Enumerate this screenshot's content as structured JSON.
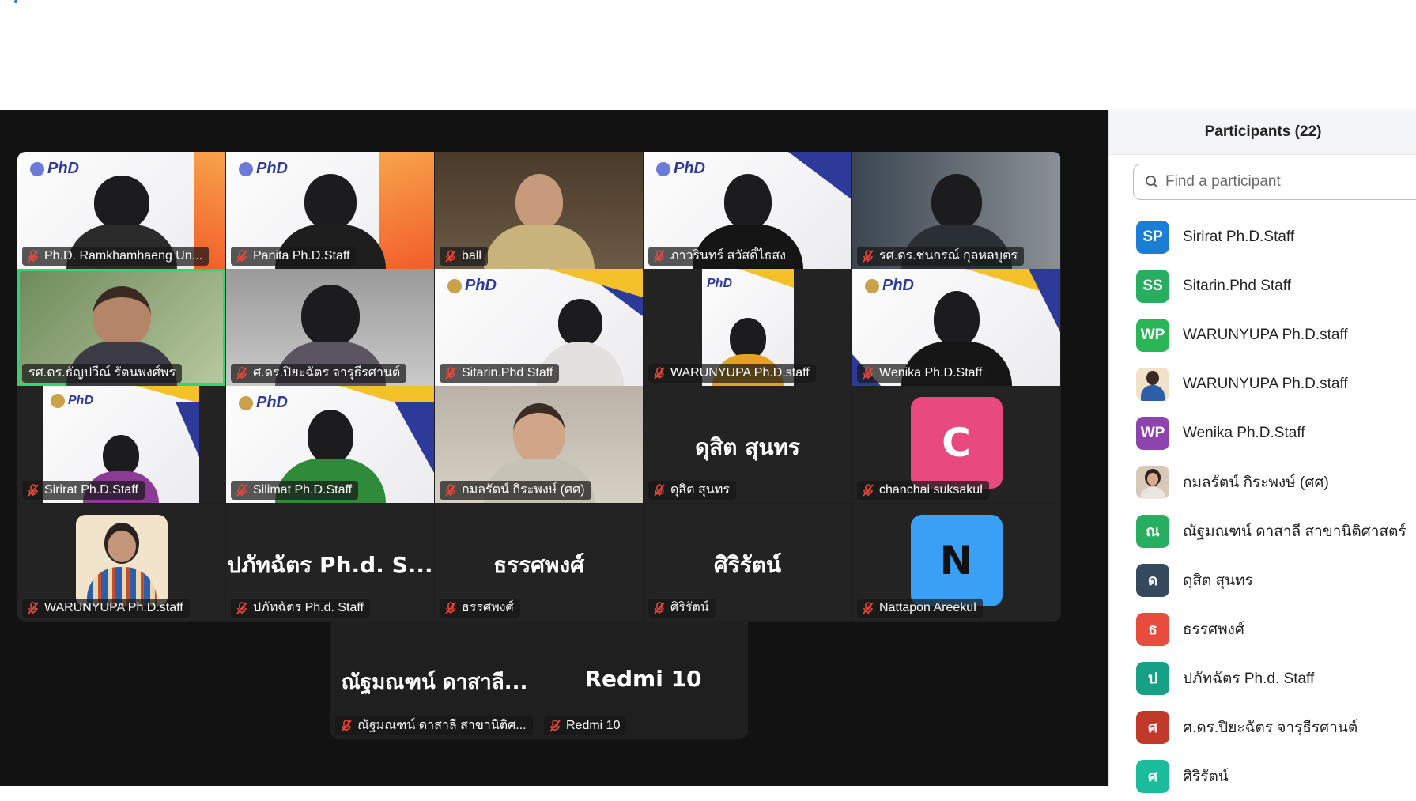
{
  "tiles": [
    {
      "name": "Ph.D. Ramkhamhaeng Un..."
    },
    {
      "name": "Panita Ph.D.Staff"
    },
    {
      "name": "ball"
    },
    {
      "name": "ภาวรินทร์ สวัสดิ์ไธสง"
    },
    {
      "name": "รศ.ดร.ชนกรณ์ กุลหลบุตร"
    },
    {
      "name": "รศ.ดร.ธัญปวีณ์ รัตนพงศ์พร"
    },
    {
      "name": "ศ.ดร.ปิยะฉัตร จารุธีรศานต์"
    },
    {
      "name": "Sitarin.Phd Staff"
    },
    {
      "name": "WARUNYUPA Ph.D.staff"
    },
    {
      "name": "Wenika Ph.D.Staff"
    },
    {
      "name": "Sirirat Ph.D.Staff"
    },
    {
      "name": "Silimat Ph.D.Staff"
    },
    {
      "name": "กมลรัตน์ กิระพงษ์ (ศศ)"
    },
    {
      "name": "ดุสิต  สุนทร",
      "big": "ดุสิต  สุนทร"
    },
    {
      "name": "chanchai suksakul",
      "letter": "C"
    },
    {
      "name": "WARUNYUPA Ph.D.staff"
    },
    {
      "name": "ปภัทฉัตร Ph.d. Staff",
      "big": "ปภัทฉัตร Ph.d. S..."
    },
    {
      "name": "ธรรศพงศ์",
      "big": "ธรรศพงศ์"
    },
    {
      "name": "ศิริรัตน์",
      "big": "ศิริรัตน์"
    },
    {
      "name": "Nattapon Areekul",
      "letter": "N"
    },
    {
      "name": "ณัฐมณฑน์ ดาสาลี สาขานิติศ...",
      "big": "ณัฐมณฑน์ ดาสาลี..."
    },
    {
      "name": "Redmi 10",
      "big": "Redmi 10"
    }
  ],
  "panel": {
    "title": "Participants (22)",
    "search_placeholder": "Find a participant",
    "participants": [
      {
        "initials": "SP",
        "name": "Sirirat Ph.D.Staff",
        "color": "#1a7fd4"
      },
      {
        "initials": "SS",
        "name": "Sitarin.Phd Staff",
        "color": "#27ae60"
      },
      {
        "initials": "WP",
        "name": "WARUNYUPA Ph.D.staff",
        "color": "#2ab657"
      },
      {
        "initials": "",
        "name": "WARUNYUPA Ph.D.staff",
        "color": "#f0e1c8"
      },
      {
        "initials": "WP",
        "name": "Wenika Ph.D.Staff",
        "color": "#8e44ad"
      },
      {
        "initials": "",
        "name": "กมลรัตน์ กิระพงษ์ (ศศ)",
        "color": "#d9c7b8"
      },
      {
        "initials": "ณ",
        "name": "ณัฐมณฑน์ ดาสาลี สาขานิติศาสตร์",
        "color": "#27ae60"
      },
      {
        "initials": "ด",
        "name": "ดุสิต  สุนทร",
        "color": "#34495e"
      },
      {
        "initials": "ธ",
        "name": "ธรรศพงศ์",
        "color": "#e74c3c"
      },
      {
        "initials": "ป",
        "name": "ปภัทฉัตร Ph.d. Staff",
        "color": "#16a085"
      },
      {
        "initials": "ศ",
        "name": "ศ.ดร.ปิยะฉัตร จารุธีรศานต์",
        "color": "#c0392b"
      },
      {
        "initials": "ศ",
        "name": "ศิริรัตน์",
        "color": "#1abc9c"
      }
    ]
  },
  "colors": {
    "tile_c": "#e84a7f",
    "tile_n": "#3aa0f5",
    "active_speaker": "#2ed573"
  }
}
